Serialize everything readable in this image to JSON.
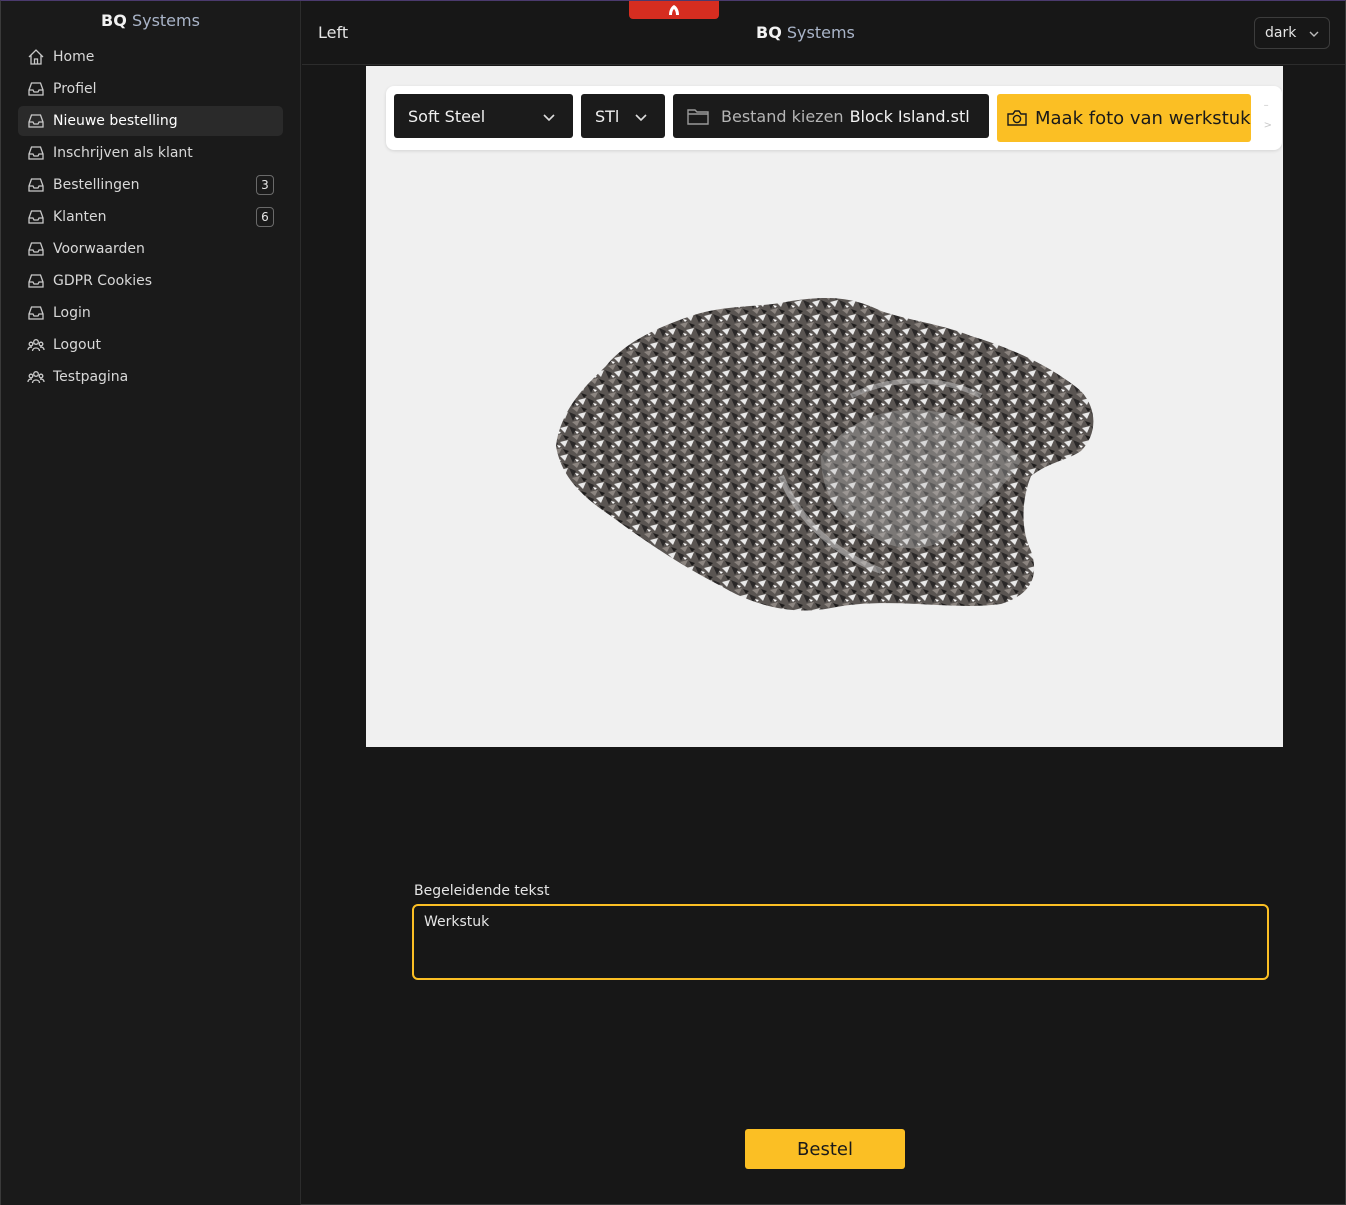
{
  "app": {
    "brand_bold": "BQ",
    "brand_light": "Systems"
  },
  "sidebar": {
    "items": [
      {
        "label": "Home",
        "icon": "home-icon"
      },
      {
        "label": "Profiel",
        "icon": "inbox-icon"
      },
      {
        "label": "Nieuwe bestelling",
        "icon": "inbox-icon",
        "active": true
      },
      {
        "label": "Inschrijven als klant",
        "icon": "inbox-icon"
      },
      {
        "label": "Bestellingen",
        "icon": "inbox-icon",
        "badge": "3"
      },
      {
        "label": "Klanten",
        "icon": "inbox-icon",
        "badge": "6"
      },
      {
        "label": "Voorwaarden",
        "icon": "inbox-icon"
      },
      {
        "label": "GDPR Cookies",
        "icon": "inbox-icon"
      },
      {
        "label": "Login",
        "icon": "inbox-icon"
      },
      {
        "label": "Logout",
        "icon": "users-icon"
      },
      {
        "label": "Testpagina",
        "icon": "users-icon"
      }
    ]
  },
  "header": {
    "left_label": "Left",
    "title_bold": "BQ",
    "title_light": "Systems",
    "theme_value": "dark"
  },
  "toolbar": {
    "material_value": "Soft Steel",
    "format_value": "STl",
    "file_label": "Bestand kiezen",
    "file_name": "Block Island.stl",
    "photo_label": "Maak foto van werkstuk"
  },
  "form": {
    "description_label": "Begeleidende tekst",
    "description_value": "Werkstuk",
    "order_label": "Bestel"
  },
  "colors": {
    "accent": "#fbbf24",
    "background": "#171717",
    "sidebar": "#1a1a1a",
    "viewer_bg": "#f0f0f0",
    "red_tab": "#d62d20"
  }
}
